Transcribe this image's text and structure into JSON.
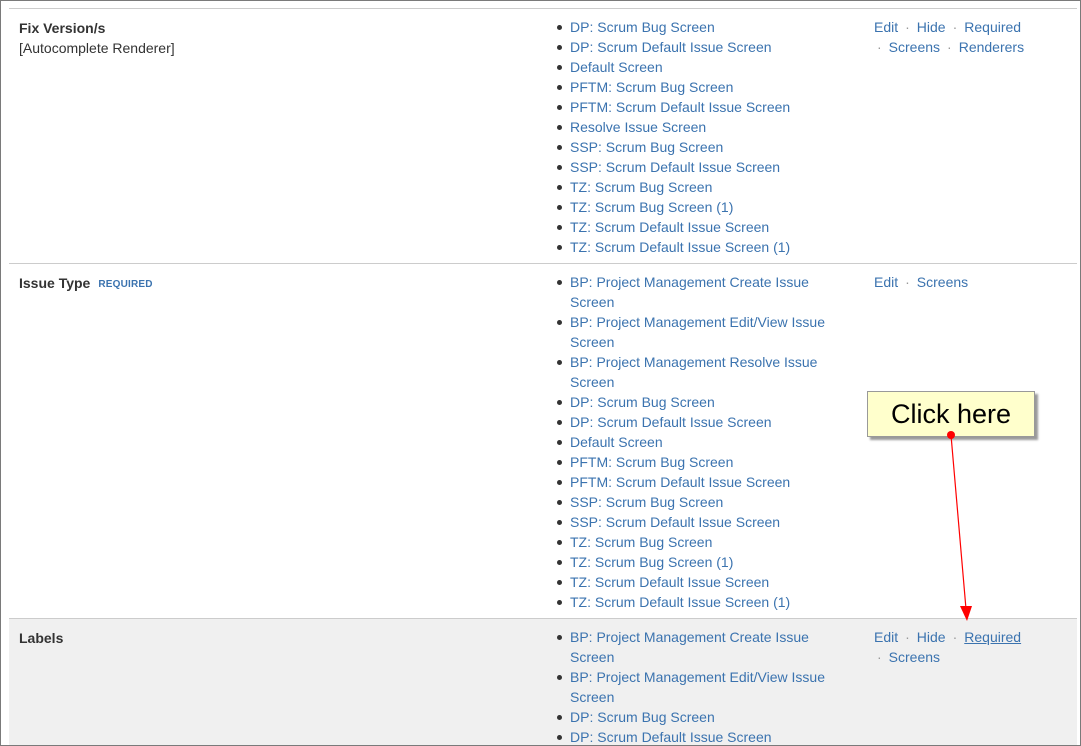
{
  "rows": [
    {
      "name": "Fix Version/s",
      "renderer": "[Autocomplete Renderer]",
      "required_badge": "",
      "screens": [
        "DP: Scrum Bug Screen",
        "DP: Scrum Default Issue Screen",
        "Default Screen",
        "PFTM: Scrum Bug Screen",
        "PFTM: Scrum Default Issue Screen",
        "Resolve Issue Screen",
        "SSP: Scrum Bug Screen",
        "SSP: Scrum Default Issue Screen",
        "TZ: Scrum Bug Screen",
        "TZ: Scrum Bug Screen (1)",
        "TZ: Scrum Default Issue Screen",
        "TZ: Scrum Default Issue Screen (1)"
      ],
      "ops_line1": [
        "Edit",
        "Hide",
        "Required"
      ],
      "ops_line2": [
        "Screens",
        "Renderers"
      ]
    },
    {
      "name": "Issue Type",
      "renderer": "",
      "required_badge": "REQUIRED",
      "screens": [
        "BP: Project Management Create Issue Screen",
        "BP: Project Management Edit/View Issue Screen",
        "BP: Project Management Resolve Issue Screen",
        "DP: Scrum Bug Screen",
        "DP: Scrum Default Issue Screen",
        "Default Screen",
        "PFTM: Scrum Bug Screen",
        "PFTM: Scrum Default Issue Screen",
        "SSP: Scrum Bug Screen",
        "SSP: Scrum Default Issue Screen",
        "TZ: Scrum Bug Screen",
        "TZ: Scrum Bug Screen (1)",
        "TZ: Scrum Default Issue Screen",
        "TZ: Scrum Default Issue Screen (1)"
      ],
      "ops_line1": [
        "Edit",
        "Screens"
      ],
      "ops_line2": []
    },
    {
      "name": "Labels",
      "renderer": "",
      "required_badge": "",
      "screens": [
        "BP: Project Management Create Issue Screen",
        "BP: Project Management Edit/View Issue Screen",
        "DP: Scrum Bug Screen",
        "DP: Scrum Default Issue Screen"
      ],
      "ops_line1": [
        "Edit",
        "Hide",
        "Required"
      ],
      "ops_line2": [
        "Screens"
      ]
    }
  ],
  "callout": {
    "text": "Click here"
  },
  "colors": {
    "link": "#3b73af",
    "highlight_row": "#f0f0f0",
    "callout_bg": "#ffffcc",
    "arrow": "#ff0000"
  }
}
